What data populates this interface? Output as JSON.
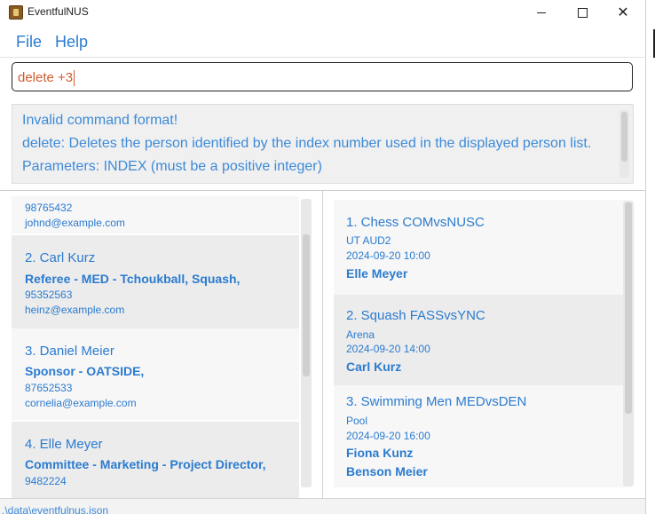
{
  "window": {
    "title": "EventfulNUS",
    "controls": {
      "minimize": "minimize",
      "maximize": "maximize",
      "close": "✕"
    }
  },
  "menu": {
    "file": "File",
    "help": "Help"
  },
  "command": {
    "value": "delete +3"
  },
  "result": {
    "line1": "Invalid command format!",
    "line2": "delete: Deletes the person identified by the index number used in the displayed person list.",
    "line3": "Parameters: INDEX (must be a positive integer)"
  },
  "persons": [
    {
      "phone": "98765432",
      "email": "johnd@example.com"
    },
    {
      "title": "2. Carl Kurz",
      "role": "Referee - MED - Tchoukball, Squash,",
      "phone": "95352563",
      "email": "heinz@example.com"
    },
    {
      "title": "3. Daniel Meier",
      "role": "Sponsor - OATSIDE,",
      "phone": "87652533",
      "email": "cornelia@example.com"
    },
    {
      "title": "4. Elle Meyer",
      "role": "Committee - Marketing - Project Director,",
      "phone": "9482224"
    }
  ],
  "events": [
    {
      "title": "1. Chess COMvsNUSC",
      "venue": "UT AUD2",
      "datetime": "2024-09-20 10:00",
      "people": [
        "Elle Meyer"
      ]
    },
    {
      "title": "2. Squash FASSvsYNC",
      "venue": "Arena",
      "datetime": "2024-09-20 14:00",
      "people": [
        "Carl Kurz"
      ]
    },
    {
      "title": "3. Swimming Men MEDvsDEN",
      "venue": "Pool",
      "datetime": "2024-09-20 16:00",
      "people": [
        "Fiona Kunz",
        "Benson Meier"
      ]
    }
  ],
  "status": {
    "path": ".\\data\\eventfulnus.json"
  }
}
